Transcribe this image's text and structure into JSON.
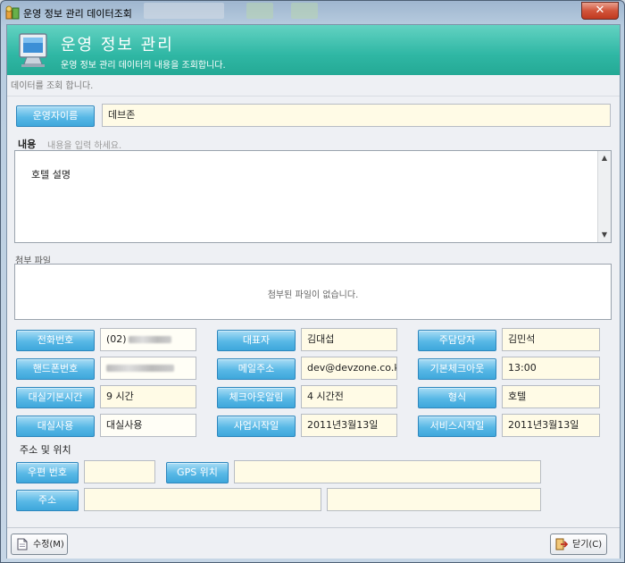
{
  "window": {
    "title": "운영 정보 관리 데이터조회",
    "close_label": "✕"
  },
  "header": {
    "title": "운영 정보 관리",
    "subtitle": "운영 정보 관리 데이터의 내용을 조회합니다."
  },
  "hint": "데이터를 조회 합니다.",
  "operator": {
    "label": "운영자이름",
    "value": "데브존"
  },
  "content": {
    "label": "내용",
    "placeholder": "내용을 입력 하세요.",
    "text": "호텔 설명"
  },
  "attachment": {
    "label": "첨부 파일",
    "empty_text": "첨부된 파일이 없습니다."
  },
  "fields": {
    "phone": {
      "label": "전화번호",
      "value": "(02)"
    },
    "ceo": {
      "label": "대표자",
      "value": "김대섭"
    },
    "main_manager": {
      "label": "주담당자",
      "value": "김민석"
    },
    "mobile": {
      "label": "핸드폰번호",
      "value": ""
    },
    "email": {
      "label": "메일주소",
      "value": "dev@devzone.co.kr"
    },
    "checkout": {
      "label": "기본체크아웃",
      "value": "13:00"
    },
    "rental_hours": {
      "label": "대실기본시간",
      "value": "9 시간"
    },
    "checkout_alarm": {
      "label": "체크아웃알림",
      "value": "4 시간전"
    },
    "type": {
      "label": "형식",
      "value": "호텔"
    },
    "rental_use": {
      "label": "대실사용",
      "value": "대실사용"
    },
    "biz_start": {
      "label": "사업시작일",
      "value": "2011년3월13일"
    },
    "service_start": {
      "label": "서비스시작일",
      "value": "2011년3월13일"
    }
  },
  "address": {
    "section_label": "주소 및 위치",
    "zip_label": "우편 번호",
    "zip_value": "",
    "gps_label": "GPS 위치",
    "gps_value": "",
    "addr_label": "주소",
    "addr1": "",
    "addr2": ""
  },
  "footer": {
    "edit_label": "수정(M)",
    "close_label": "닫기(C)"
  },
  "colors": {
    "header": "#2fb7a4",
    "label_button": "#4fb3e3",
    "value_field": "#fffbe6"
  }
}
